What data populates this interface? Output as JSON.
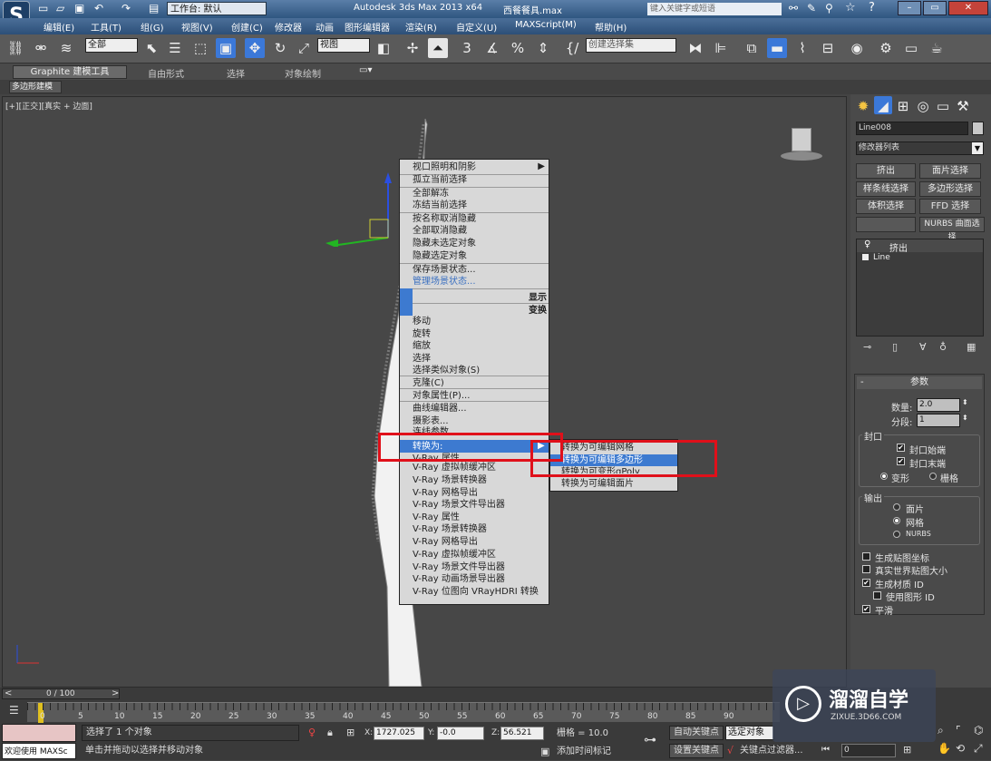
{
  "title": {
    "workspace": "工作台: 默认",
    "app": "Autodesk 3ds Max  2013 x64",
    "file": "西餐餐具.max",
    "search_placeholder": "键入关键字或短语"
  },
  "menu": [
    "编辑(E)",
    "工具(T)",
    "组(G)",
    "视图(V)",
    "创建(C)",
    "修改器",
    "动画",
    "图形编辑器",
    "渲染(R)",
    "自定义(U)",
    "MAXScript(M)",
    "帮助(H)"
  ],
  "toolbar": {
    "filter": "全部",
    "refcoord": "视图",
    "selset": "创建选择集",
    "snap3": "3",
    "snap_pct": "%",
    "spin": "n"
  },
  "ribbon": {
    "tabs": [
      "Graphite 建模工具",
      "自由形式",
      "选择",
      "对象绘制"
    ],
    "sub": "多边形建模"
  },
  "viewport": {
    "label": "[+][正交][真实 + 边面]"
  },
  "context_menu": {
    "items": [
      "视口照明和阴影",
      "孤立当前选择",
      "全部解冻",
      "冻结当前选择",
      "按名称取消隐藏",
      "全部取消隐藏",
      "隐藏未选定对象",
      "隐藏选定对象",
      "保存场景状态...",
      "管理场景状态...",
      "移动",
      "旋转",
      "缩放",
      "选择",
      "选择类似对象(S)",
      "克隆(C)",
      "对象属性(P)...",
      "曲线编辑器...",
      "摄影表...",
      "连线参数...",
      "转换为:",
      "V-Ray 属性",
      "V-Ray 虚拟帧缓冲区",
      "V-Ray 场景转换器",
      "V-Ray 网格导出",
      "V-Ray 场景文件导出器",
      "V-Ray 属性",
      "V-Ray 场景转换器",
      "V-Ray 网格导出",
      "V-Ray 虚拟帧缓冲区",
      "V-Ray 场景文件导出器",
      "V-Ray 动画场景导出器",
      "V-Ray 位图向 VRayHDRI 转换"
    ],
    "quad_display": "显示",
    "quad_transform": "变换"
  },
  "submenu": {
    "items": [
      "转换为可编辑网格",
      "转换为可编辑多边形",
      "转换为可变形gPoly",
      "转换为可编辑面片"
    ]
  },
  "cmd": {
    "object_name": "Line008",
    "modifier_list": "修改器列表",
    "buttons": [
      "挤出",
      "面片选择",
      "样条线选择",
      "多边形选择",
      "体积选择",
      "FFD 选择",
      "",
      "NURBS 曲面选择"
    ],
    "stack": [
      "挤出",
      "Line"
    ],
    "params": {
      "title": "参数",
      "amount_label": "数量:",
      "amount": "2.0",
      "segments_label": "分段:",
      "segments": "1",
      "cap_title": "封口",
      "cap_start": "封口始端",
      "cap_end": "封口末端",
      "morph": "变形",
      "grid": "栅格",
      "output_title": "输出",
      "out_patch": "面片",
      "out_mesh": "网格",
      "out_nurbs": "NURBS",
      "gen_map": "生成贴图坐标",
      "real_world": "真实世界贴图大小",
      "gen_mat": "生成材质 ID",
      "use_shape": "使用图形 ID",
      "smooth": "平滑"
    }
  },
  "timeline": {
    "frame": "0 / 100",
    "ticks": [
      "0",
      "5",
      "10",
      "15",
      "20",
      "25",
      "30",
      "35",
      "40",
      "45",
      "50",
      "55",
      "60",
      "65",
      "70",
      "75",
      "80",
      "85",
      "90"
    ]
  },
  "status": {
    "welcome": "欢迎使用 MAXSc",
    "selected": "选择了 1 个对象",
    "prompt": "单击并拖动以选择并移动对象",
    "x": "1727.025",
    "y": "-0.0",
    "z": "56.521",
    "grid": "栅格 = 10.0",
    "autokey": "自动关键点",
    "selobj": "选定对象",
    "setkey": "设置关键点",
    "keyfilter": "关键点过滤器...",
    "addtime": "添加时间标记",
    "frame_field": "0"
  },
  "watermark": {
    "name": "溜溜自学",
    "url": "ZIXUE.3D66.COM"
  }
}
